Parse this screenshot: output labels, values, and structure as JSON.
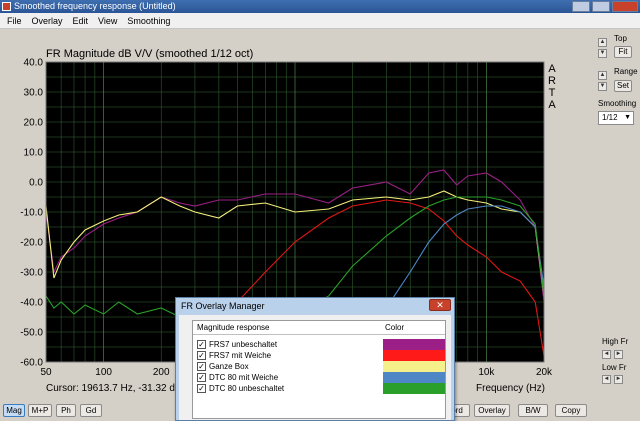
{
  "window": {
    "title": "Smoothed frequency response (Untitled)"
  },
  "menu": [
    "File",
    "Overlay",
    "Edit",
    "View",
    "Smoothing"
  ],
  "chart_data": {
    "type": "line",
    "title": "FR Magnitude dB V/V (smoothed 1/12 oct)",
    "xlabel": "Frequency (Hz)",
    "ylabel": "",
    "x_scale": "log",
    "xlim": [
      50,
      20000
    ],
    "ylim": [
      -60,
      40
    ],
    "yticks": [
      "40.0",
      "30.0",
      "20.0",
      "10.0",
      "0.0",
      "-10.0",
      "-20.0",
      "-30.0",
      "-40.0",
      "-50.0",
      "-60.0"
    ],
    "xticks": [
      {
        "value": 50,
        "label": "50"
      },
      {
        "value": 100,
        "label": "100"
      },
      {
        "value": 200,
        "label": "200"
      },
      {
        "value": 10000,
        "label": "10k"
      },
      {
        "value": 20000,
        "label": "20k"
      }
    ],
    "grid": true,
    "background": "#000000",
    "watermark": [
      "A",
      "R",
      "T",
      "A"
    ],
    "cursor_text": "Cursor: 19613.7 Hz, -31.32 dB",
    "series": [
      {
        "name": "FRS7 unbeschaltet",
        "color": "#9b1f86",
        "x": [
          50,
          55,
          60,
          70,
          80,
          100,
          120,
          150,
          200,
          250,
          300,
          400,
          500,
          700,
          1000,
          1500,
          2000,
          3000,
          4000,
          5000,
          6000,
          7000,
          8000,
          10000,
          12000,
          15000,
          18000,
          20000
        ],
        "y": [
          -10,
          -30,
          -25,
          -22,
          -18,
          -14,
          -12,
          -10,
          -5,
          -7,
          -8,
          -6,
          -6,
          -4,
          -4,
          -7,
          -2,
          0,
          -4,
          3,
          4,
          -1,
          2,
          3,
          0,
          -6,
          -15,
          -40
        ]
      },
      {
        "name": "FRS7 mit Weiche",
        "color": "#e01616",
        "x": [
          200,
          300,
          500,
          700,
          1000,
          1500,
          2000,
          3000,
          4000,
          5000,
          6000,
          7000,
          8000,
          10000,
          12000,
          15000,
          18000,
          20000
        ],
        "y": [
          -70,
          -55,
          -40,
          -30,
          -20,
          -12,
          -8,
          -6,
          -7,
          -9,
          -13,
          -18,
          -21,
          -25,
          -30,
          -33,
          -40,
          -58
        ]
      },
      {
        "name": "Ganze Box",
        "color": "#f4ef7a",
        "x": [
          50,
          55,
          60,
          70,
          80,
          100,
          120,
          150,
          200,
          250,
          300,
          400,
          500,
          700,
          1000,
          1500,
          2000,
          3000,
          4000,
          5000,
          6000,
          7000,
          8000,
          10000,
          12000,
          15000,
          18000,
          20000
        ],
        "y": [
          -8,
          -32,
          -26,
          -20,
          -16,
          -13,
          -11,
          -10,
          -5,
          -8,
          -10,
          -12,
          -8,
          -7,
          -10,
          -9,
          -6,
          -5,
          -6,
          -5,
          -3,
          -5,
          -6,
          -7,
          -9,
          -10,
          -15,
          -38
        ]
      },
      {
        "name": "DTC 80 mit Weiche",
        "color": "#4f86c6",
        "x": [
          1500,
          2000,
          3000,
          4000,
          5000,
          6000,
          7000,
          8000,
          10000,
          12000,
          15000,
          18000,
          20000
        ],
        "y": [
          -60,
          -50,
          -42,
          -30,
          -20,
          -14,
          -11,
          -9,
          -8,
          -8,
          -10,
          -15,
          -35
        ]
      },
      {
        "name": "DTC 80 unbeschaltet",
        "color": "#2aa02a",
        "x": [
          50,
          55,
          60,
          70,
          80,
          100,
          120,
          150,
          200,
          250,
          300,
          400,
          500,
          700,
          1000,
          1500,
          2000,
          3000,
          4000,
          5000,
          6000,
          7000,
          8000,
          10000,
          12000,
          15000,
          18000,
          20000
        ],
        "y": [
          -38,
          -42,
          -40,
          -44,
          -41,
          -44,
          -40,
          -44,
          -42,
          -45,
          -43,
          -48,
          -47,
          -46,
          -44,
          -38,
          -28,
          -18,
          -12,
          -8,
          -6,
          -5,
          -5,
          -5,
          -6,
          -8,
          -14,
          -38
        ]
      }
    ]
  },
  "controls": {
    "top_label": "Top",
    "top_button": "Fit",
    "range_label": "Range",
    "range_button": "Set",
    "smoothing_label": "Smoothing",
    "smoothing_value": "1/12",
    "high_fr_label": "High Fr",
    "low_fr_label": "Low Fr"
  },
  "bottom_buttons": {
    "left": [
      "Mag",
      "M+P",
      "Ph",
      "Gd"
    ],
    "right": [
      "ord",
      "Overlay",
      "B/W",
      "Copy"
    ],
    "active": "Mag"
  },
  "overlay_manager": {
    "title": "FR Overlay Manager",
    "col_name": "Magnitude response",
    "col_color": "Color",
    "rows": [
      {
        "name": "FRS7 unbeschaltet",
        "checked": true,
        "color": "#9b1f86"
      },
      {
        "name": "FRS7 mit Weiche",
        "checked": true,
        "color": "#ff1a1a"
      },
      {
        "name": "Ganze Box",
        "checked": true,
        "color": "#f6f08a"
      },
      {
        "name": "DTC 80 mit Weiche",
        "checked": true,
        "color": "#4f86c6"
      },
      {
        "name": "DTC 80 unbeschaltet",
        "checked": true,
        "color": "#2aa02a"
      }
    ]
  }
}
